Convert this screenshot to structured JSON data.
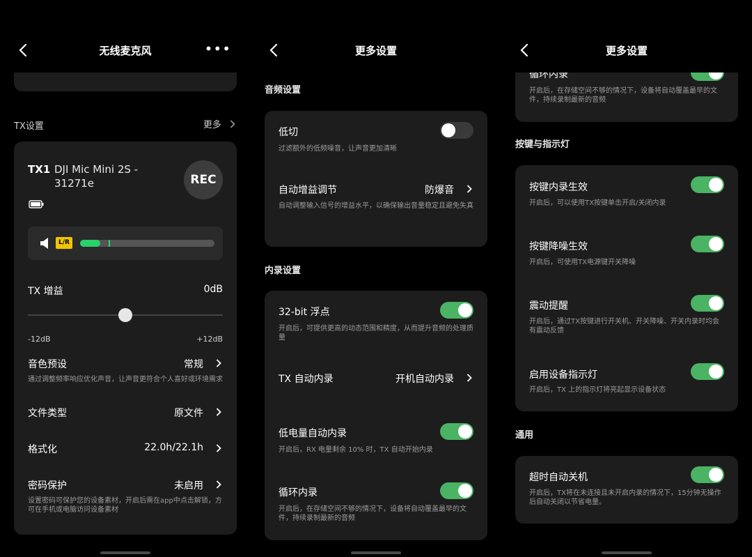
{
  "colors": {
    "accent": "#4bb364",
    "card": "#1d1d1d",
    "badge": "#f0c400"
  },
  "s1": {
    "title": "无线麦克风",
    "tx_section": "TX设置",
    "tx_more": "更多",
    "tx_id": "TX1",
    "device_name_1": "DJI Mic Mini 2S -",
    "device_name_2": "31271e",
    "rec": "REC",
    "lr_badge": "L/R",
    "gain_label": "TX 增益",
    "gain_value": "0dB",
    "gain_min": "-12dB",
    "gain_max": "+12dB",
    "gain_level": 0.5,
    "meter_level": 0.15,
    "tone_label": "音色预设",
    "tone_value": "常规",
    "tone_desc": "通过调整频率响应优化声音，让声音更符合个人喜好或环境需求",
    "filetype_label": "文件类型",
    "filetype_value": "原文件",
    "format_label": "格式化",
    "format_value": "22.0h/22.1h",
    "password_label": "密码保护",
    "password_value": "未启用",
    "password_desc": "设置密码可保护您的设备素材，开启后需在app中点击解锁，方可在手机或电脑访问设备素材"
  },
  "s2": {
    "title": "更多设置",
    "audio_section": "音频设置",
    "lowcut_label": "低切",
    "lowcut_desc": "过滤额外的低频噪音，让声音更加清晰",
    "agc_label": "自动增益调节",
    "agc_value": "防爆音",
    "agc_desc": "自动调整输入信号的增益水平，以确保输出音量稳定且避免失真",
    "rec_section": "内录设置",
    "float_label": "32-bit 浮点",
    "float_desc": "开启后，可提供更高的动态范围和精度，从而提升音频的处理质量",
    "txrec_label": "TX 自动内录",
    "txrec_value": "开机自动内录",
    "lowbat_label": "低电量自动内录",
    "lowbat_desc": "开启后，RX 电量剩余 10% 时，TX 自动开始内录",
    "loop_label": "循环内录",
    "loop_desc": "开启后，在存储空间不够的情况下，设备将自动覆盖最早的文件，持续录制最新的音频"
  },
  "s3": {
    "title": "更多设置",
    "loop_label": "循环内录",
    "loop_desc": "开启后，在存储空间不够的情况下，设备将自动覆盖最早的文件，持续录制最新的音频",
    "keys_section": "按键与指示灯",
    "keyrec_label": "按键内录生效",
    "keyrec_desc": "开启后，可以使用TX按键单击开启/关闭内录",
    "keyns_label": "按键降噪生效",
    "keyns_desc": "开启后，可使用TX电源键开关降噪",
    "vibrate_label": "震动提醒",
    "vibrate_desc": "开启后，通过TX按键进行开关机、开关降噪、开关内录时均会有震动反馈",
    "led_label": "启用设备指示灯",
    "led_desc": "开启后，TX 上的指示灯将亮起显示设备状态",
    "general_section": "通用",
    "autooff_label": "超时自动关机",
    "autooff_desc": "开启后，TX将在未连接且未开启内录的情况下，15分钟无操作后自动关闭以节省电量。"
  }
}
